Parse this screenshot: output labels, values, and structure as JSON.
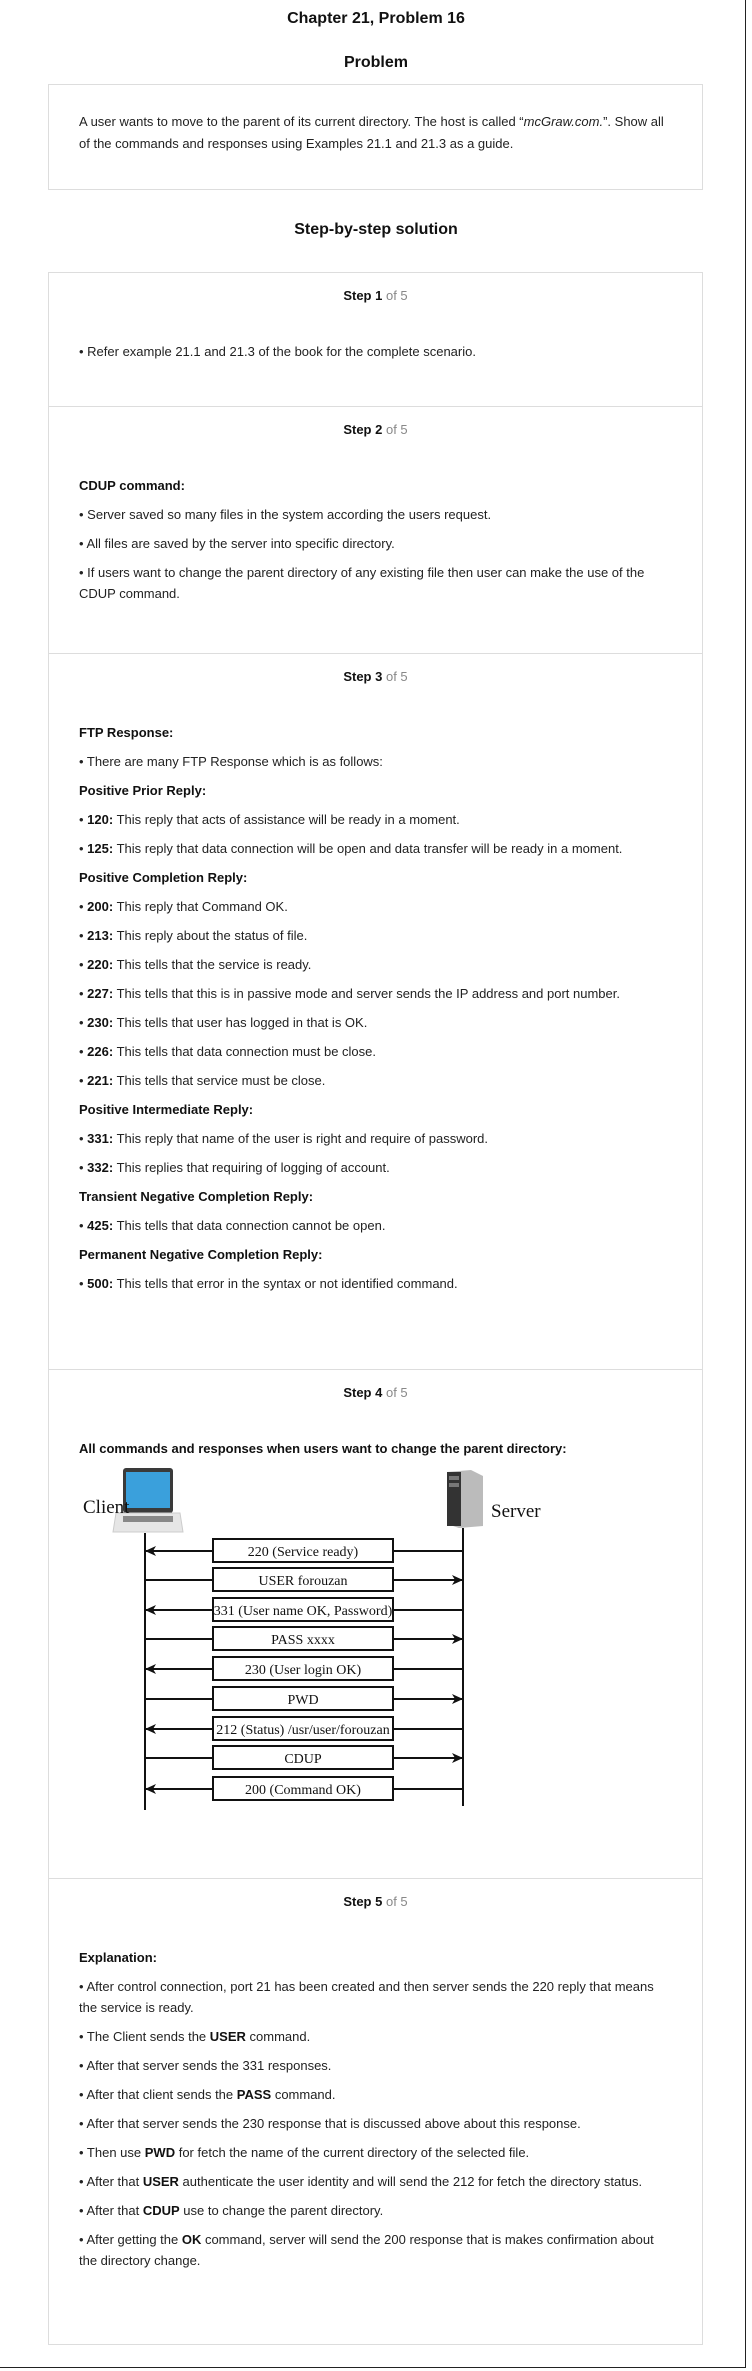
{
  "title": "Chapter 21, Problem 16",
  "problem": {
    "heading": "Problem",
    "text_before": "A user wants to move to the parent of its current directory. The host is called “",
    "host": "mcGraw.com.",
    "text_after": "”. Show all of the commands and responses using Examples 21.1 and 21.3 as a guide."
  },
  "solution_heading": "Step-by-step solution",
  "steps": [
    {
      "label": "Step 1",
      "of": "of 5",
      "paras": [
        {
          "pre": "• Refer example 21.1 and 21.3 of the book for the complete scenario.",
          "b": "",
          "post": ""
        }
      ]
    },
    {
      "label": "Step 2",
      "of": "of 5",
      "paras": [
        {
          "pre": "",
          "b": "CDUP command:",
          "post": ""
        },
        {
          "pre": "• Server saved so many files in the system according the users request.",
          "b": "",
          "post": ""
        },
        {
          "pre": "• All files are saved by the server into specific directory.",
          "b": "",
          "post": ""
        },
        {
          "pre": "• If users want to change the parent directory of any existing file then user can make the use of the CDUP command.",
          "b": "",
          "post": ""
        }
      ]
    },
    {
      "label": "Step 3",
      "of": "of 5",
      "paras": [
        {
          "pre": "",
          "b": "FTP Response:",
          "post": ""
        },
        {
          "pre": "• There are many FTP Response which is as follows:",
          "b": "",
          "post": ""
        },
        {
          "pre": "",
          "b": "Positive Prior Reply:",
          "post": ""
        },
        {
          "pre": "• ",
          "b": "120:",
          "post": " This reply that acts of assistance will be ready in a moment."
        },
        {
          "pre": "• ",
          "b": "125:",
          "post": " This reply that data connection will be open and data transfer will be ready in a moment."
        },
        {
          "pre": "",
          "b": "Positive Completion Reply:",
          "post": ""
        },
        {
          "pre": "• ",
          "b": "200:",
          "post": " This reply that Command OK."
        },
        {
          "pre": "• ",
          "b": "213:",
          "post": " This reply about the status of file."
        },
        {
          "pre": "• ",
          "b": "220:",
          "post": " This tells that the service is ready."
        },
        {
          "pre": "• ",
          "b": "227:",
          "post": " This tells that this is in passive mode and server sends the IP address and port number."
        },
        {
          "pre": "• ",
          "b": "230:",
          "post": " This tells that user has logged in that is OK."
        },
        {
          "pre": "• ",
          "b": "226:",
          "post": " This tells that data connection must be close."
        },
        {
          "pre": "• ",
          "b": "221:",
          "post": " This tells that service must be close."
        },
        {
          "pre": "",
          "b": "Positive Intermediate Reply:",
          "post": ""
        },
        {
          "pre": "• ",
          "b": "331:",
          "post": " This reply that name of the user is right and require of password."
        },
        {
          "pre": "• ",
          "b": "332:",
          "post": " This replies that requiring of logging of account."
        },
        {
          "pre": "",
          "b": "Transient Negative Completion Reply:",
          "post": ""
        },
        {
          "pre": "• ",
          "b": "425:",
          "post": " This tells that data connection cannot be open."
        },
        {
          "pre": "",
          "b": "Permanent Negative Completion Reply:",
          "post": ""
        },
        {
          "pre": "• ",
          "b": "500:",
          "post": " This tells that error in the syntax or not identified command."
        }
      ]
    },
    {
      "label": "Step 4",
      "of": "of 5",
      "paras": [
        {
          "pre": "",
          "b": "All commands and responses when users want to change the parent directory:",
          "post": ""
        }
      ]
    },
    {
      "label": "Step 5",
      "of": "of 5",
      "paras": [
        {
          "pre": "",
          "b": "Explanation:",
          "post": ""
        },
        {
          "pre": "• After control connection, port 21 has been created and then server sends the 220 reply that means the service is ready.",
          "b": "",
          "post": ""
        },
        {
          "pre": "• The Client sends the ",
          "b": "USER",
          "post": " command."
        },
        {
          "pre": "• After that server sends the 331 responses.",
          "b": "",
          "post": ""
        },
        {
          "pre": "• After that client sends the ",
          "b": "PASS",
          "post": " command."
        },
        {
          "pre": "• After that server sends the 230 response that is discussed above about this response.",
          "b": "",
          "post": ""
        },
        {
          "pre": "• Then use ",
          "b": "PWD",
          "post": " for fetch the name of the current directory of the selected file."
        },
        {
          "pre": "• After that ",
          "b": "USER",
          "post": " authenticate the user identity and will send the 212 for fetch the directory status."
        },
        {
          "pre": "• After that ",
          "b": "CDUP",
          "post": " use to change the parent directory."
        },
        {
          "pre": "• After getting the ",
          "b": "OK",
          "post": " command, server will send the 200 response that is makes confirmation about the directory change."
        }
      ]
    }
  ],
  "diagram": {
    "client_label": "Client",
    "server_label": "Server",
    "messages": [
      {
        "label": "220 (Service ready)",
        "direction": "to-client"
      },
      {
        "label": "USER forouzan",
        "direction": "to-server"
      },
      {
        "label": "331 (User name OK, Password)",
        "direction": "to-client"
      },
      {
        "label": "PASS xxxx",
        "direction": "to-server"
      },
      {
        "label": "230 (User  login OK)",
        "direction": "to-client"
      },
      {
        "label": "PWD",
        "direction": "to-server"
      },
      {
        "label": "212 (Status) /usr/user/forouzan",
        "direction": "to-client"
      },
      {
        "label": "CDUP",
        "direction": "to-server"
      },
      {
        "label": "200 (Command OK)",
        "direction": "to-client"
      }
    ]
  }
}
